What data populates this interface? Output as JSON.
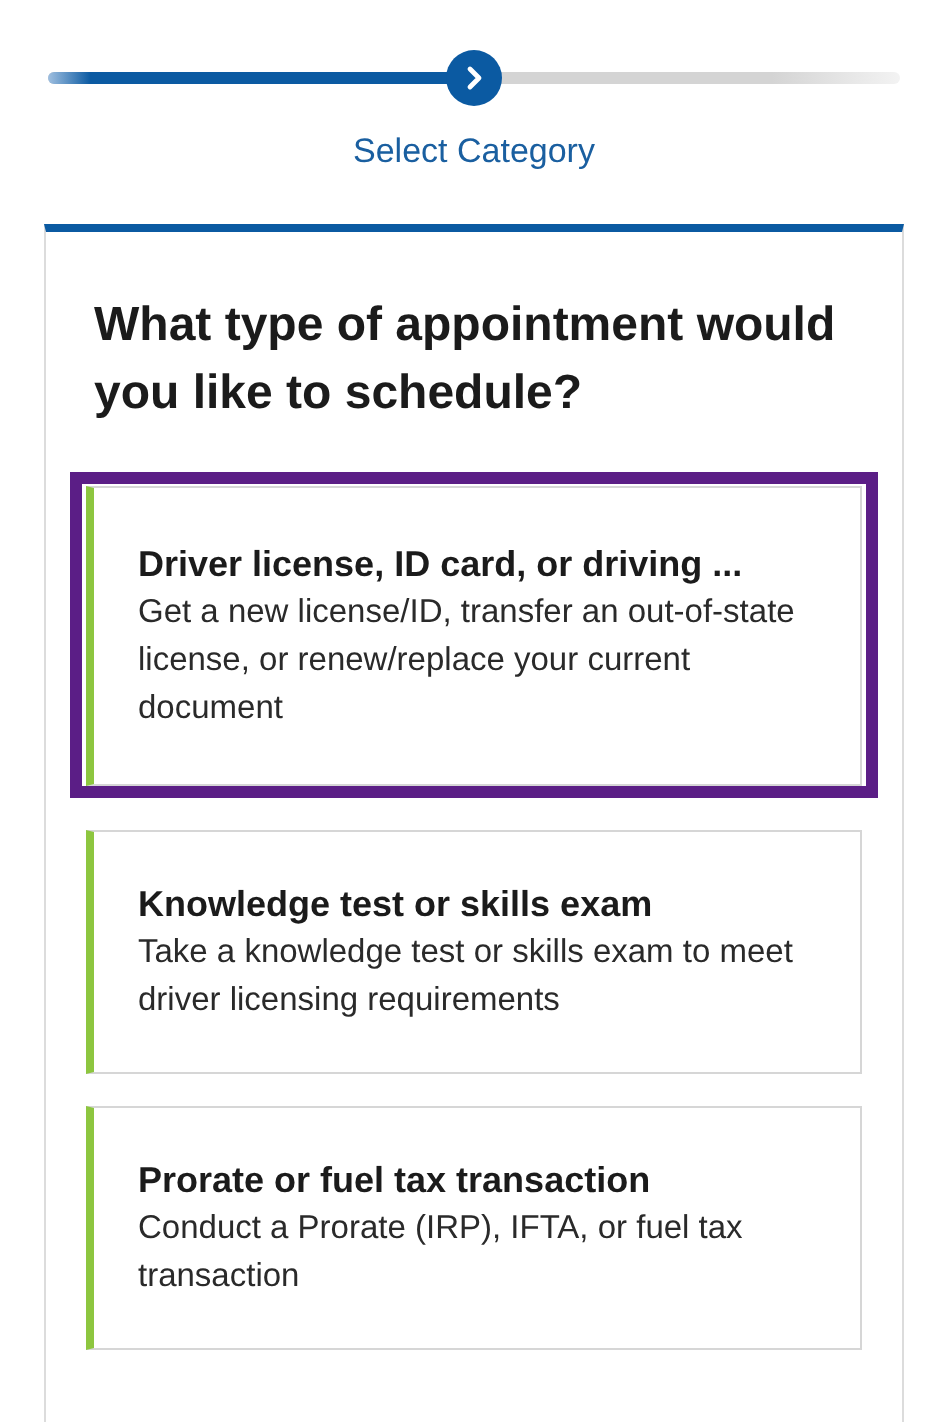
{
  "progress": {
    "level": 0.5,
    "step_label": "Select Category"
  },
  "question": "What type of appointment would you like to schedule?",
  "options": [
    {
      "title": "Driver license, ID card, or driving ...",
      "description": "Get a new license/ID, transfer an out-of-state license, or renew/replace your current document",
      "selected": true
    },
    {
      "title": "Knowledge test or skills exam",
      "description": "Take a knowledge test or skills exam to meet driver licensing requirements",
      "selected": false
    },
    {
      "title": "Prorate or fuel tax transaction",
      "description": "Conduct a Prorate (IRP), IFTA, or fuel tax transaction",
      "selected": false
    }
  ]
}
